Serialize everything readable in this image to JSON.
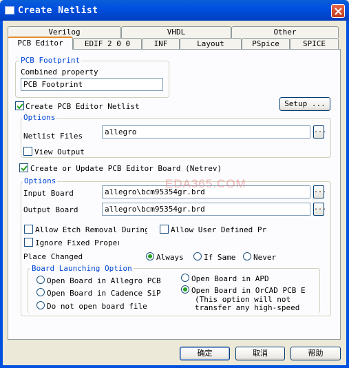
{
  "window": {
    "title": "Create Netlist"
  },
  "tabs_row1": [
    "Verilog",
    "VHDL",
    "Other"
  ],
  "tabs_row2": [
    "PCB Editor",
    "EDIF 2 0 0",
    "INF",
    "Layout",
    "PSpice",
    "SPICE"
  ],
  "footprint": {
    "group_label": "PCB Footprint",
    "combined_label": "Combined property",
    "combined_value": "PCB Footprint"
  },
  "create_netlist": {
    "label": "Create PCB Editor Netlist",
    "checked": true,
    "setup_label": "Setup ..."
  },
  "options1": {
    "group_label": "Options",
    "netlist_files_label": "Netlist Files",
    "netlist_files_value": "allegro",
    "view_output_label": "View Output",
    "view_output_checked": false,
    "browse_label": "..."
  },
  "update_board": {
    "label": "Create or Update PCB Editor Board (Netrev)",
    "checked": true
  },
  "options2": {
    "group_label": "Options",
    "input_board_label": "Input Board",
    "input_board_value": "allegro\\bcm95354gr.brd",
    "output_board_label": "Output Board",
    "output_board_value": "allegro\\bcm95354gr.brd",
    "allow_etch_label": "Allow Etch Removal During E",
    "allow_user_label": "Allow User Defined Prop",
    "ignore_fixed_label": "Ignore Fixed Propert",
    "place_changed_label": "Place Changed",
    "radio_always": "Always",
    "radio_if_same": "If Same",
    "radio_never": "Never",
    "place_changed_selected": "Always"
  },
  "launch": {
    "group_label": "Board Launching Option",
    "opt_allegro": "Open Board in Allegro PCB Ed:",
    "opt_sip": "Open Board in Cadence SiP",
    "opt_none": "Do not open board file",
    "opt_apd": "Open Board in APD",
    "opt_orcad": "Open Board in OrCAD PCB Edi",
    "note_line1": "(This option will not",
    "note_line2": "transfer any high-speed",
    "selected": "opt_orcad"
  },
  "watermark": "EDA365.COM",
  "footer": {
    "ok": "确定",
    "cancel": "取消",
    "help": "帮助"
  }
}
